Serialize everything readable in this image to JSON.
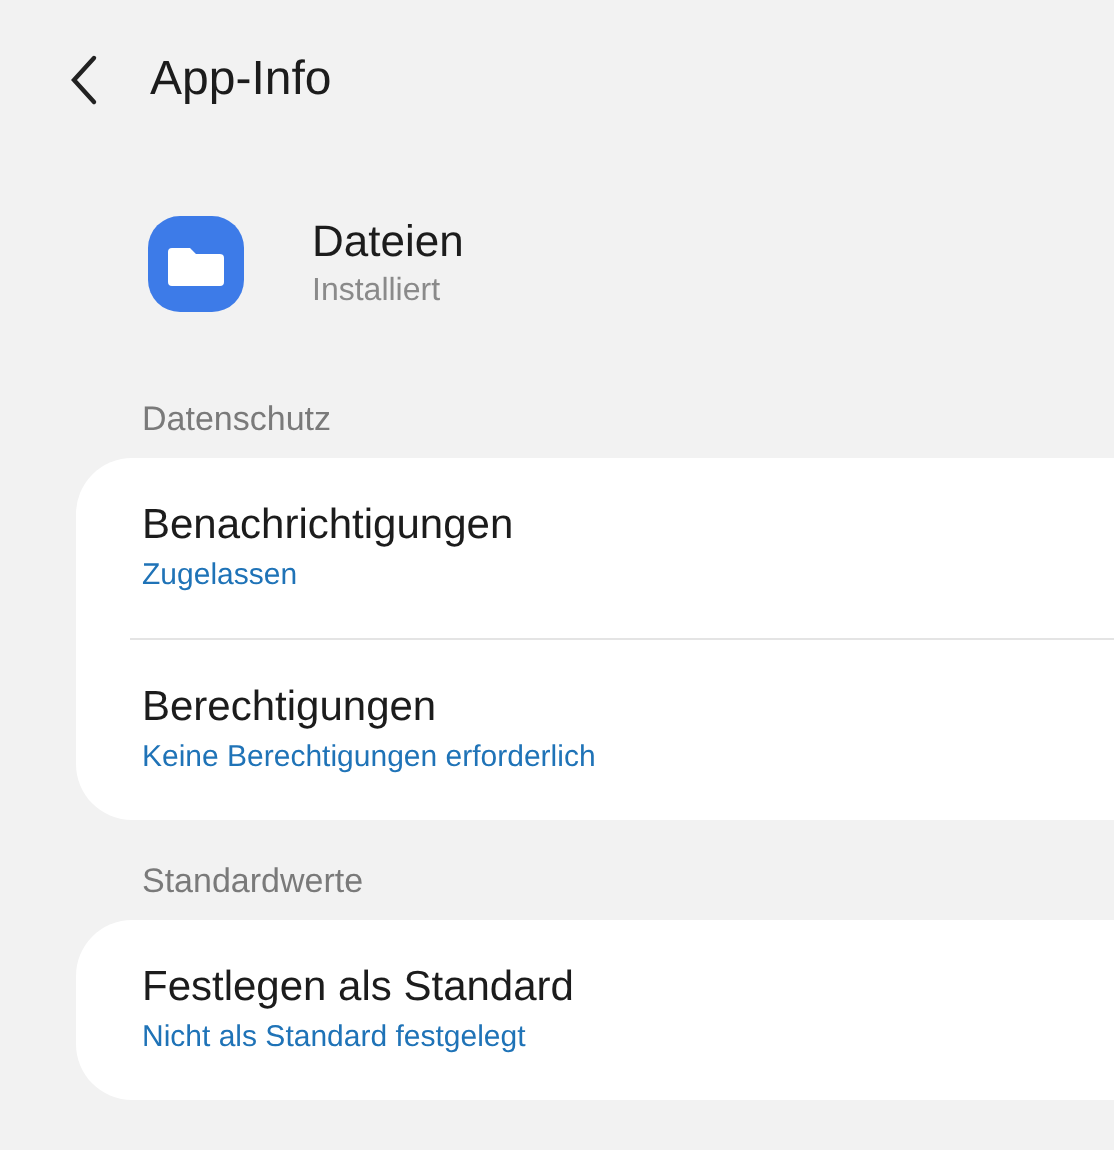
{
  "header": {
    "title": "App-Info"
  },
  "app": {
    "name": "Dateien",
    "status": "Installiert"
  },
  "sections": [
    {
      "title": "Datenschutz",
      "items": [
        {
          "title": "Benachrichtigungen",
          "subtitle": "Zugelassen"
        },
        {
          "title": "Berechtigungen",
          "subtitle": "Keine Berechtigungen erforderlich"
        }
      ]
    },
    {
      "title": "Standardwerte",
      "items": [
        {
          "title": "Festlegen als Standard",
          "subtitle": "Nicht als Standard festgelegt"
        }
      ]
    }
  ]
}
